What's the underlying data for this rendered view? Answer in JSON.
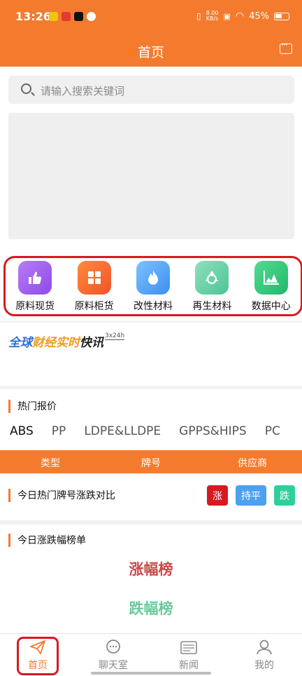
{
  "status_bar": {
    "time": "13:26",
    "net_speed_value": "8.00",
    "net_speed_unit": "KB/s",
    "battery": "45%"
  },
  "header": {
    "title": "首页"
  },
  "search": {
    "placeholder": "请输入搜索关键词"
  },
  "categories": [
    {
      "label": "原料现货",
      "icon": "thumbs-up-icon",
      "color": "#a05cf0"
    },
    {
      "label": "原料柜货",
      "icon": "grid-icon",
      "color": "#f66c2a"
    },
    {
      "label": "改性材料",
      "icon": "flame-icon",
      "color": "#3d9ff5"
    },
    {
      "label": "再生材料",
      "icon": "recycle-icon",
      "color": "#5ccf9e"
    },
    {
      "label": "数据中心",
      "icon": "chart-icon",
      "color": "#34c97e"
    }
  ],
  "news_ticker": {
    "part1": "全球",
    "part2": "财经实时",
    "part3": "快讯",
    "part4": "3x24h"
  },
  "hot_quotes": {
    "title": "热门报价",
    "tabs": [
      "ABS",
      "PP",
      "LDPE&LLDPE",
      "GPPS&HIPS",
      "PC"
    ],
    "active_tab": "ABS",
    "columns": [
      "类型",
      "牌号",
      "供应商"
    ]
  },
  "compare": {
    "title": "今日热门牌号涨跌对比",
    "badges": [
      {
        "label": "涨",
        "color": "#d71a21"
      },
      {
        "label": "持平",
        "color": "#4ea0f0"
      },
      {
        "label": "跌",
        "color": "#2fcf9c"
      }
    ]
  },
  "ranking": {
    "title": "今日涨跌幅榜单",
    "up": "涨幅榜",
    "down": "跌幅榜"
  },
  "bottom_nav": [
    {
      "label": "首页",
      "icon": "paper-plane-icon"
    },
    {
      "label": "聊天室",
      "icon": "chat-bubble-icon"
    },
    {
      "label": "新闻",
      "icon": "news-icon"
    },
    {
      "label": "我的",
      "icon": "user-icon"
    }
  ],
  "colors": {
    "brand": "#f47b2e",
    "highlight": "#d71a21"
  }
}
